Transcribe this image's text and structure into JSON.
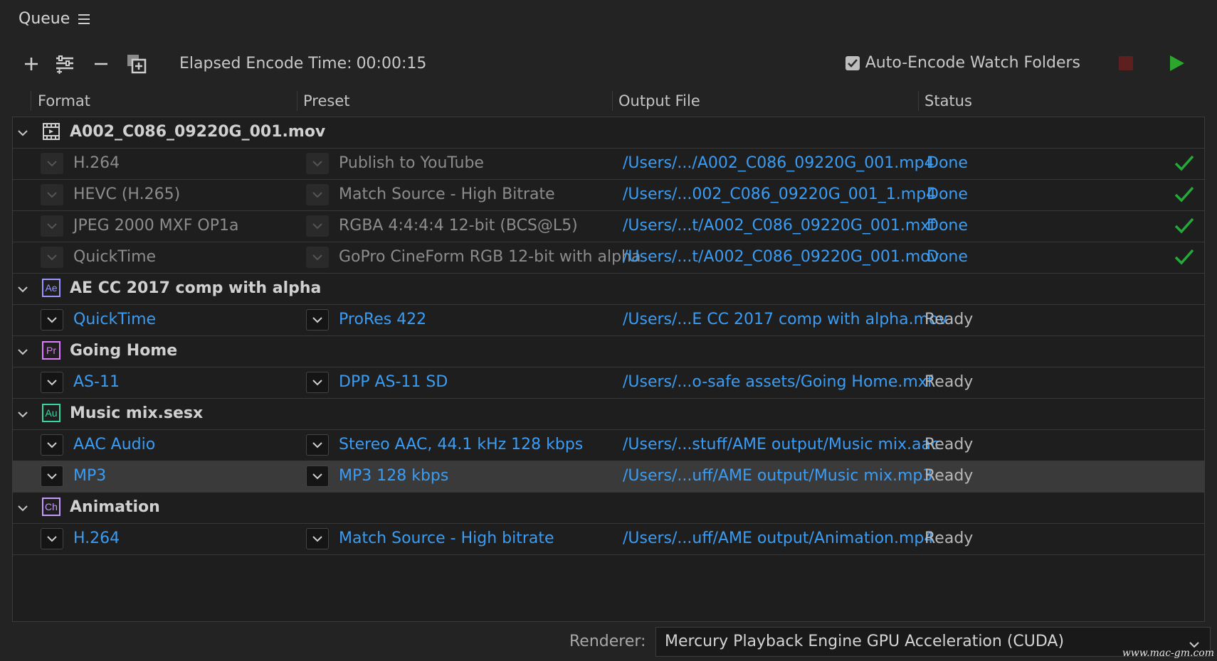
{
  "panel": {
    "title": "Queue"
  },
  "toolbar": {
    "elapsed_label": "Elapsed Encode Time:",
    "elapsed_value": "00:00:15",
    "auto_encode_label": "Auto-Encode Watch Folders",
    "auto_encode_checked": true
  },
  "columns": {
    "format": "Format",
    "preset": "Preset",
    "output": "Output File",
    "status": "Status"
  },
  "groups": [
    {
      "name": "A002_C086_09220G_001.mov",
      "icon": "film-clip-icon",
      "items": [
        {
          "format": "H.264",
          "preset": "Publish to YouTube",
          "output": "/Users/.../A002_C086_09220G_001.mp4",
          "status": "Done"
        },
        {
          "format": "HEVC (H.265)",
          "preset": "Match Source - High Bitrate",
          "output": "/Users/...002_C086_09220G_001_1.mp4",
          "status": "Done"
        },
        {
          "format": "JPEG 2000 MXF OP1a",
          "preset": "RGBA 4:4:4:4 12-bit (BCS@L5)",
          "output": "/Users/...t/A002_C086_09220G_001.mxf",
          "status": "Done"
        },
        {
          "format": "QuickTime",
          "preset": "GoPro CineForm RGB 12-bit with alpha",
          "output": "/Users/...t/A002_C086_09220G_001.mov",
          "status": "Done"
        }
      ]
    },
    {
      "name": "AE CC 2017 comp with alpha",
      "icon": "after-effects-icon",
      "badge": "Ae",
      "items": [
        {
          "format": "QuickTime",
          "preset": "ProRes 422",
          "output": "/Users/...E CC 2017 comp with alpha.mov",
          "status": "Ready"
        }
      ]
    },
    {
      "name": "Going Home",
      "icon": "premiere-icon",
      "badge": "Pr",
      "items": [
        {
          "format": "AS-11",
          "preset": "DPP AS-11 SD",
          "output": "/Users/...o-safe assets/Going Home.mxf",
          "status": "Ready"
        }
      ]
    },
    {
      "name": "Music mix.sesx",
      "icon": "audition-icon",
      "badge": "Au",
      "items": [
        {
          "format": "AAC Audio",
          "preset": "Stereo AAC, 44.1 kHz 128 kbps",
          "output": "/Users/...stuff/AME output/Music mix.aac",
          "status": "Ready"
        },
        {
          "format": "MP3",
          "preset": "MP3 128 kbps",
          "output": "/Users/...uff/AME output/Music mix.mp3",
          "status": "Ready",
          "selected": true
        }
      ]
    },
    {
      "name": "Animation",
      "icon": "character-animator-icon",
      "badge": "Ch",
      "items": [
        {
          "format": "H.264",
          "preset": "Match Source - High bitrate",
          "output": "/Users/...uff/AME output/Animation.mp4",
          "status": "Ready"
        }
      ]
    }
  ],
  "footer": {
    "renderer_label": "Renderer:",
    "renderer_value": "Mercury Playback Engine GPU Acceleration (CUDA)",
    "watermark": "www.mac-gm.com"
  },
  "colors": {
    "link_blue": "#3b9cf3",
    "done_check": "#27a83a",
    "ae": "#9a98ff",
    "pr": "#e07cff",
    "au": "#3ad6a0",
    "ch": "#c69bff"
  }
}
